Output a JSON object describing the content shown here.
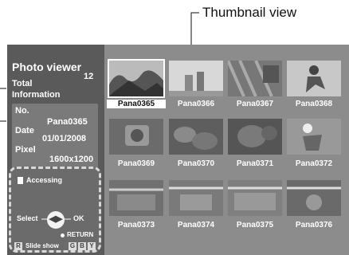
{
  "callout": {
    "label": "Thumbnail view"
  },
  "sidebar": {
    "title": "Photo viewer",
    "total_label": "Total",
    "total_value": "12",
    "info_label": "Information",
    "no_label": "No.",
    "no_value": "Pana0365",
    "date_label": "Date",
    "date_value": "01/01/2008",
    "pixel_label": "Pixel",
    "pixel_value": "1600x1200"
  },
  "status": {
    "accessing": "Accessing",
    "select": "Select",
    "ok": "OK",
    "return": "RETURN",
    "slide_show": "Slide show",
    "key_r": "R",
    "key_g": "G",
    "key_b": "B",
    "key_y": "Y"
  },
  "thumbnails": [
    {
      "name": "Pana0365",
      "selected": true
    },
    {
      "name": "Pana0366",
      "selected": false
    },
    {
      "name": "Pana0367",
      "selected": false
    },
    {
      "name": "Pana0368",
      "selected": false
    },
    {
      "name": "Pana0369",
      "selected": false
    },
    {
      "name": "Pana0370",
      "selected": false
    },
    {
      "name": "Pana0371",
      "selected": false
    },
    {
      "name": "Pana0372",
      "selected": false
    },
    {
      "name": "Pana0373",
      "selected": false
    },
    {
      "name": "Pana0374",
      "selected": false
    },
    {
      "name": "Pana0375",
      "selected": false
    },
    {
      "name": "Pana0376",
      "selected": false
    }
  ]
}
